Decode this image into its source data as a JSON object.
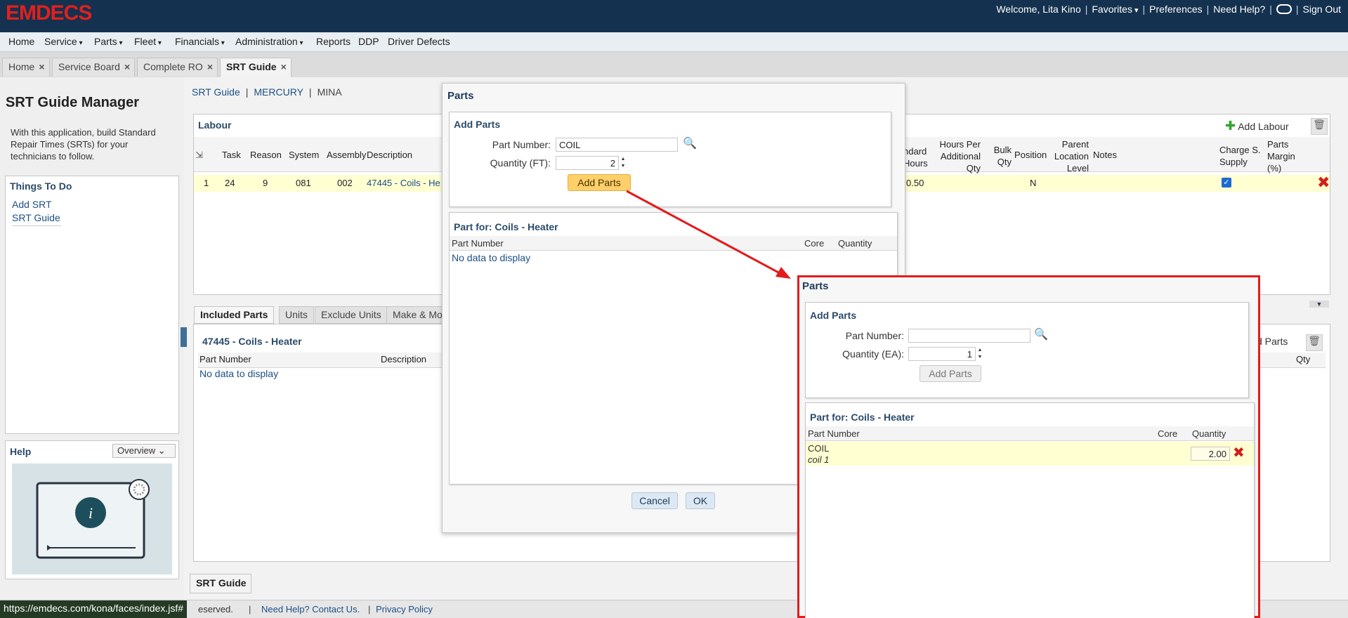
{
  "header": {
    "logo": "EMDECS",
    "welcome": "Welcome, Lita Kino",
    "favorites": "Favorites",
    "preferences": "Preferences",
    "need_help": "Need Help?",
    "sign_out": "Sign Out"
  },
  "menu": [
    "Home",
    "Service",
    "Parts",
    "Fleet",
    "Financials",
    "Administration",
    "Reports",
    "DDP",
    "Driver Defects"
  ],
  "tabs": [
    {
      "label": "Home"
    },
    {
      "label": "Service Board"
    },
    {
      "label": "Complete RO"
    },
    {
      "label": "SRT Guide"
    }
  ],
  "left": {
    "title": "SRT Guide Manager",
    "description": "With this application, build Standard Repair Times (SRTs) for your technicians to follow.",
    "things_title": "Things To Do",
    "things": [
      "Add SRT",
      "SRT Guide"
    ],
    "help_title": "Help",
    "help_select": "Overview"
  },
  "breadcrumb": [
    "SRT Guide",
    "MERCURY",
    "MINA"
  ],
  "labour": {
    "title": "Labour",
    "add_label": "Add Labour",
    "headers_left": [
      "Task",
      "Reason",
      "System",
      "Assembly",
      "Description"
    ],
    "headers_right": [
      "ndard Hours",
      "Hours Per Additional Qty",
      "Bulk Qty",
      "Position",
      "Parent Location Level",
      "Notes",
      "Charge S. Supply",
      "Parts Margin (%)"
    ],
    "row": {
      "num": "1",
      "task": "24",
      "reason": "9",
      "system": "081",
      "assembly": "002",
      "description": "47445 - Coils - He",
      "hours": "0.50",
      "position": "N"
    }
  },
  "subtabs": [
    "Included Parts",
    "Units",
    "Exclude Units",
    "Make & Mo"
  ],
  "included": {
    "title": "47445 - Coils - Heater",
    "col_part": "Part Number",
    "col_desc": "Description",
    "col_qty": "Qty",
    "nodata": "No data to display",
    "add_label": "d Parts"
  },
  "bottom_tab": "SRT Guide",
  "footer": {
    "reserved": "eserved.",
    "help": "Need Help? Contact Us.",
    "privacy": "Privacy Policy",
    "url": "https://emdecs.com/kona/faces/index.jsf#"
  },
  "dialog1": {
    "title": "Parts",
    "add_title": "Add Parts",
    "part_label": "Part Number:",
    "part_value": "COIL",
    "qty_label": "Quantity (FT):",
    "qty_value": "2",
    "add_button": "Add Parts",
    "list_title": "Part for: Coils - Heater",
    "col_part": "Part Number",
    "col_core": "Core",
    "col_qty": "Quantity",
    "nodata": "No data to display",
    "cancel": "Cancel",
    "ok": "OK"
  },
  "dialog2": {
    "title": "Parts",
    "add_title": "Add Parts",
    "part_label": "Part Number:",
    "part_value": "",
    "qty_label": "Quantity (EA):",
    "qty_value": "1",
    "add_button": "Add Parts",
    "list_title": "Part for: Coils - Heater",
    "col_part": "Part Number",
    "col_core": "Core",
    "col_qty": "Quantity",
    "row_part": "COIL",
    "row_desc": "coil 1",
    "row_qty": "2.00"
  },
  "colors": {
    "header": "#14314f",
    "logo": "#e0201d",
    "highlight": "#ffffd2",
    "arrow": "#e31b1b"
  }
}
